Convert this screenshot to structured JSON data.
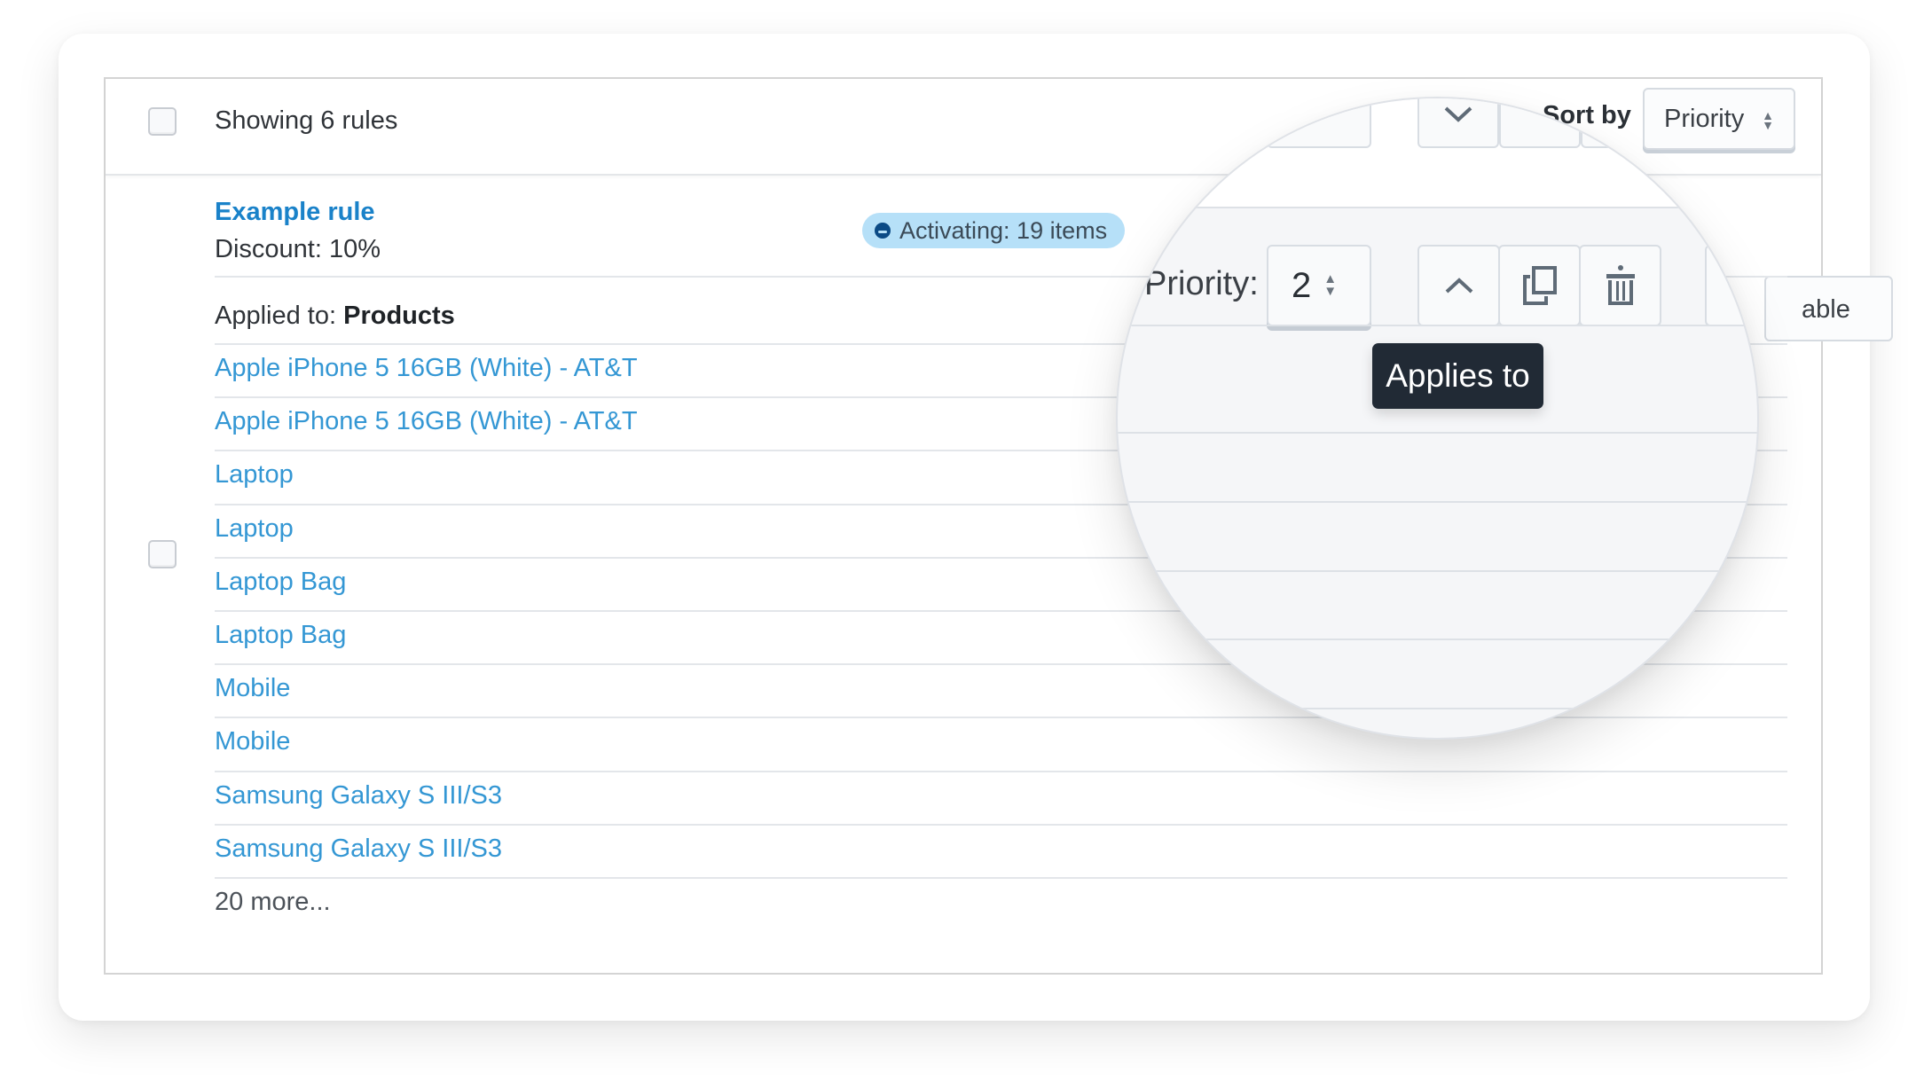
{
  "header": {
    "showing_text": "Showing 6 rules",
    "sort_by_label": "Sort by",
    "sort_select_value": "Priority"
  },
  "rule": {
    "name": "Example rule",
    "discount": "Discount: 10%",
    "status_badge": "Activating: 19 items",
    "applied_to_label": "Applied to:",
    "applied_to_value": "Products",
    "products": [
      "Apple iPhone 5 16GB (White) - AT&T",
      "Apple iPhone 5 16GB (White) - AT&T",
      "Laptop",
      "Laptop",
      "Laptop Bag",
      "Laptop Bag",
      "Mobile",
      "Mobile",
      "Samsung Galaxy S III/S3",
      "Samsung Galaxy S III/S3"
    ],
    "more_text": "20 more...",
    "partial_button_text": "able"
  },
  "magnifier": {
    "priority_label": "Priority:",
    "priority_value": "2",
    "tooltip": "Applies to",
    "buttons": [
      "move-up",
      "duplicate",
      "delete"
    ]
  },
  "colors": {
    "link": "#1a82c9",
    "product_link": "#3497d4",
    "badge_bg": "#b6e0f8",
    "badge_dot": "#0b4a85",
    "tooltip_bg": "#212a35"
  }
}
